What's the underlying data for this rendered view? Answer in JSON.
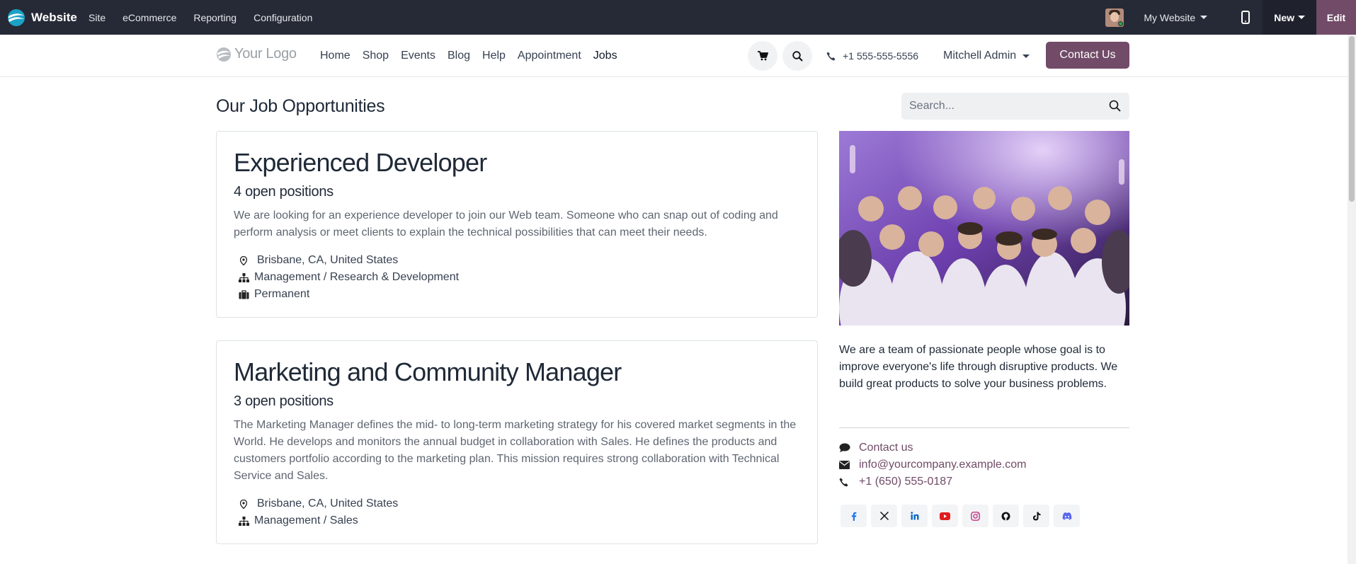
{
  "admin_bar": {
    "brand": "Website",
    "menu": [
      "Site",
      "eCommerce",
      "Reporting",
      "Configuration"
    ],
    "website_selector": "My Website",
    "new_label": "New",
    "edit_label": "Edit"
  },
  "header": {
    "logo_text": "Your Logo",
    "nav": [
      "Home",
      "Shop",
      "Events",
      "Blog",
      "Help",
      "Appointment",
      "Jobs"
    ],
    "active_nav": "Jobs",
    "phone": "+1 555-555-5556",
    "user": "Mitchell Admin",
    "contact_button": "Contact Us"
  },
  "main": {
    "title": "Our Job Opportunities",
    "search_placeholder": "Search...",
    "jobs": [
      {
        "title": "Experienced Developer",
        "positions": "4 open positions",
        "description": "We are looking for an experience developer to join our Web team. Someone who can snap out of coding and perform analysis or meet clients to explain the technical possibilities that can meet their needs.",
        "location": "Brisbane, CA, United States",
        "department": "Management / Research & Development",
        "contract": "Permanent"
      },
      {
        "title": "Marketing and Community Manager",
        "positions": "3 open positions",
        "description": "The Marketing Manager defines the mid- to long-term marketing strategy for his covered market segments in the World. He develops and monitors the annual budget in collaboration with Sales. He defines the products and customers portfolio according to the marketing plan. This mission requires strong collaboration with Technical Service and Sales.",
        "location": "Brisbane, CA, United States",
        "department": "Management / Sales"
      }
    ]
  },
  "sidebar": {
    "about": "We are a team of passionate people whose goal is to improve everyone's life through disruptive products. We build great products to solve your business problems.",
    "contact_label": "Contact us",
    "email": "info@yourcompany.example.com",
    "phone": "+1 (650) 555-0187",
    "social_icons": [
      "facebook-icon",
      "x-icon",
      "linkedin-icon",
      "youtube-icon",
      "instagram-icon",
      "github-icon",
      "tiktok-icon",
      "discord-icon"
    ]
  },
  "colors": {
    "admin_bar": "#262a36",
    "brand_primary": "#714b67",
    "youtube": "#e11d1d",
    "instagram": "#c13584",
    "linkedin": "#0a66c2",
    "discord": "#5865f2"
  }
}
